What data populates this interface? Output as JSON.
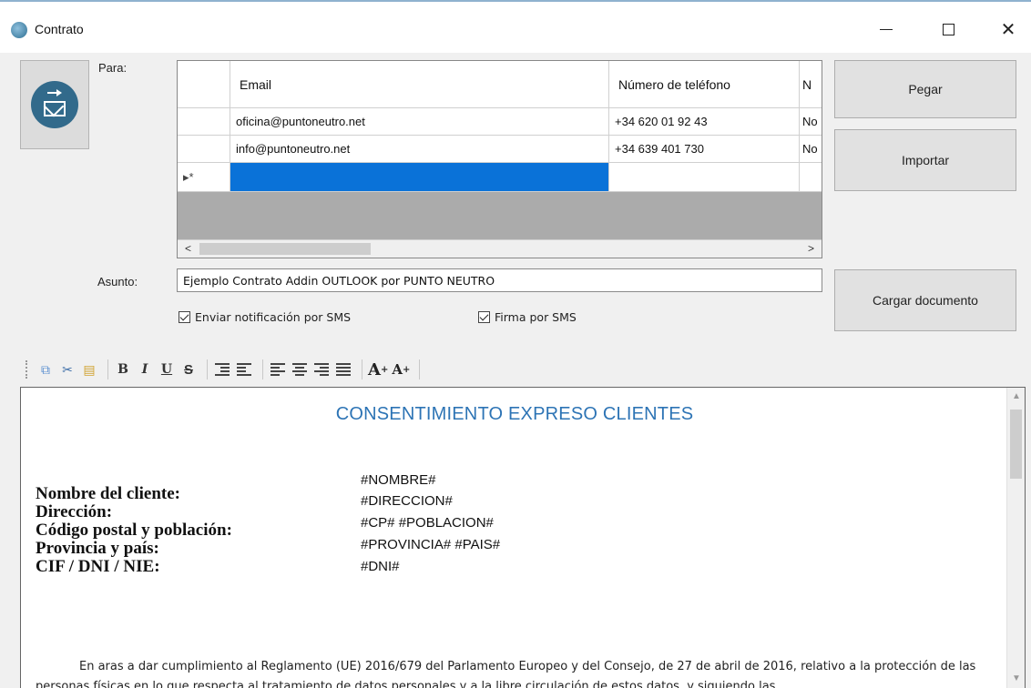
{
  "window": {
    "title": "Contrato",
    "controls": {
      "minimize": "minimize",
      "maximize": "maximize",
      "close": "✕"
    }
  },
  "recipients": {
    "label": "Para:",
    "columns": [
      "Email",
      "Número de teléfono",
      "N"
    ],
    "rows": [
      {
        "email": "oficina@puntoneutro.net",
        "phone": "+34 620 01 92 43",
        "extra": "No"
      },
      {
        "email": "info@puntoneutro.net",
        "phone": "+34 639 401 730",
        "extra": "No"
      }
    ],
    "new_row_marker": "▸*",
    "scroll_left": "<",
    "scroll_right": ">"
  },
  "buttons": {
    "pegar": "Pegar",
    "importar": "Importar",
    "cargar": "Cargar documento"
  },
  "subject": {
    "label": "Asunto:",
    "value": "Ejemplo Contrato Addin OUTLOOK por PUNTO NEUTRO"
  },
  "options": {
    "sms_notification": {
      "label": "Enviar notificación por SMS",
      "checked": true
    },
    "sms_signature": {
      "label": "Firma por SMS",
      "checked": true
    }
  },
  "toolbar": {
    "bold": "B",
    "italic": "I",
    "underline": "U",
    "strike": "S",
    "grow": "A",
    "shrink": "A"
  },
  "document": {
    "title": "CONSENTIMIENTO EXPRESO CLIENTES",
    "fields": [
      {
        "label": "Nombre del cliente:",
        "value": "#NOMBRE#"
      },
      {
        "label": "Dirección:",
        "value": "#DIRECCION#"
      },
      {
        "label": "Código postal y población:",
        "value": "#CP# #POBLACION#"
      },
      {
        "label": "Provincia y país:",
        "value": "#PROVINCIA# #PAIS#"
      },
      {
        "label": "CIF / DNI / NIE:",
        "value": "#DNI#"
      }
    ],
    "paragraph": "En aras a dar cumplimiento al Reglamento (UE) 2016/679 del Parlamento Europeo y del Consejo, de 27 de abril de 2016, relativo a la protección de las personas físicas en lo que respecta al tratamiento de datos personales y a la libre circulación de estos datos, y siguiendo las"
  }
}
